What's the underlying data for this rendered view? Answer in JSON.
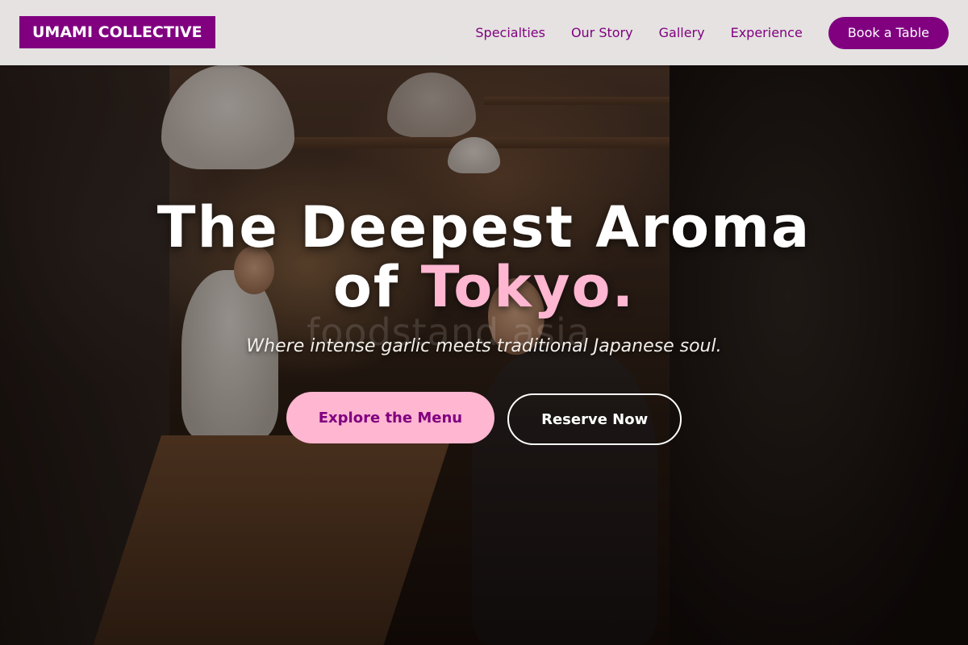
{
  "brand": {
    "logo_text": "UMAMI COLLECTIVE",
    "accent_color": "#800080"
  },
  "nav": {
    "links": [
      "Specialties",
      "Our Story",
      "Gallery",
      "Experience"
    ],
    "cta_label": "Book a Table"
  },
  "hero": {
    "headline_line1": "The Deepest Aroma",
    "headline_line2_prefix": "of ",
    "headline_line2_accent": "Tokyo.",
    "tagline": "Where intense garlic meets traditional Japanese soul.",
    "primary_cta": "Explore the Menu",
    "secondary_cta": "Reserve Now",
    "highlight_color": "#ffb6d1",
    "background_image": "Night izakaya counter scene with chef and diner",
    "watermark": "foodstand asia"
  }
}
